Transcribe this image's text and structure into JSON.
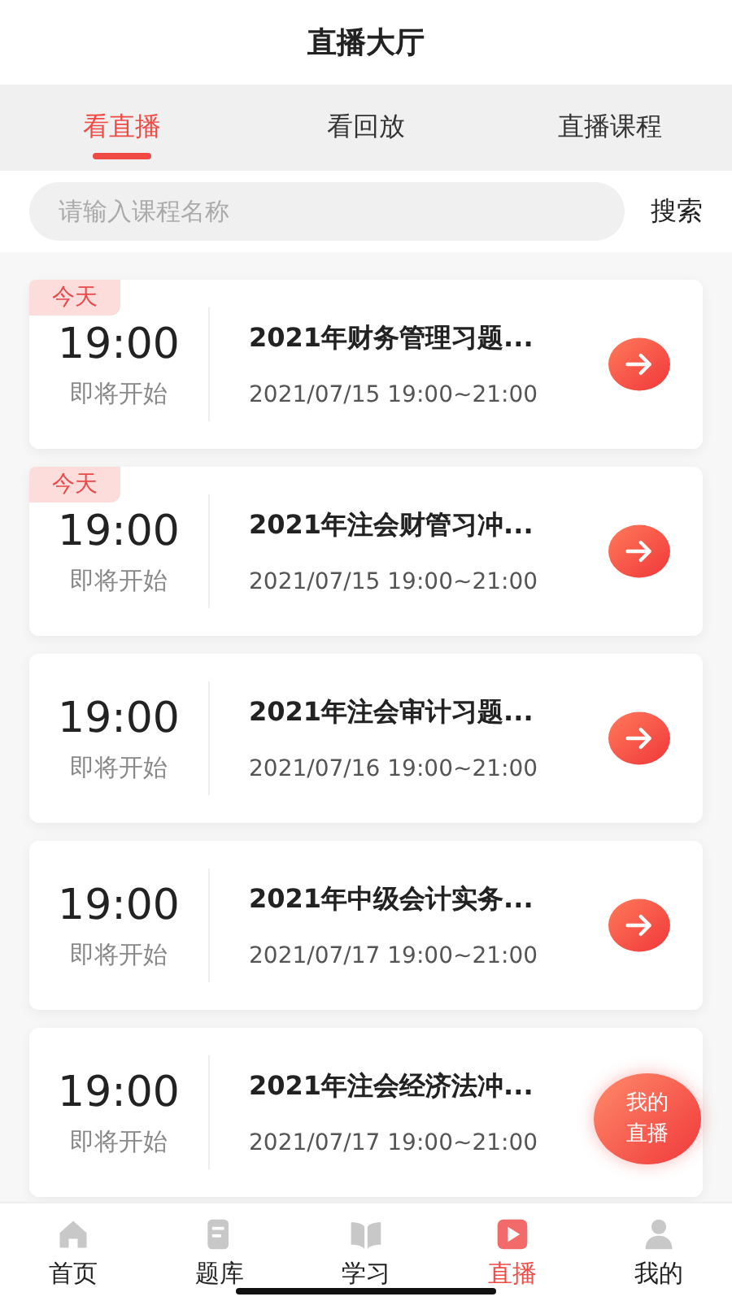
{
  "header": {
    "title": "直播大厅"
  },
  "tabs": [
    {
      "label": "看直播",
      "selected": true
    },
    {
      "label": "看回放",
      "selected": false
    },
    {
      "label": "直播课程",
      "selected": false
    }
  ],
  "search": {
    "placeholder": "请输入课程名称",
    "button": "搜索"
  },
  "courses": [
    {
      "tag": "今天",
      "time": "19:00",
      "status": "即将开始",
      "title": "2021年财务管理习题...",
      "schedule": "2021/07/15 19:00~21:00",
      "arrow": true
    },
    {
      "tag": "今天",
      "time": "19:00",
      "status": "即将开始",
      "title": "2021年注会财管习冲...",
      "schedule": "2021/07/15 19:00~21:00",
      "arrow": true
    },
    {
      "time": "19:00",
      "status": "即将开始",
      "title": "2021年注会审计习题...",
      "schedule": "2021/07/16 19:00~21:00",
      "arrow": true
    },
    {
      "time": "19:00",
      "status": "即将开始",
      "title": "2021年中级会计实务...",
      "schedule": "2021/07/17 19:00~21:00",
      "arrow": true
    },
    {
      "time": "19:00",
      "status": "即将开始",
      "title": "2021年注会经济法冲...",
      "schedule": "2021/07/17 19:00~21:00",
      "arrow": false
    }
  ],
  "floating_button": {
    "line_1": "我的",
    "line_2": "直播"
  },
  "bottom_nav": [
    {
      "label": "首页",
      "kind": "home",
      "selected": false
    },
    {
      "label": "题库",
      "kind": "bank",
      "selected": false
    },
    {
      "label": "学习",
      "kind": "study",
      "selected": false
    },
    {
      "label": "直播",
      "kind": "live",
      "selected": true
    },
    {
      "label": "我的",
      "kind": "me",
      "selected": false
    }
  ]
}
